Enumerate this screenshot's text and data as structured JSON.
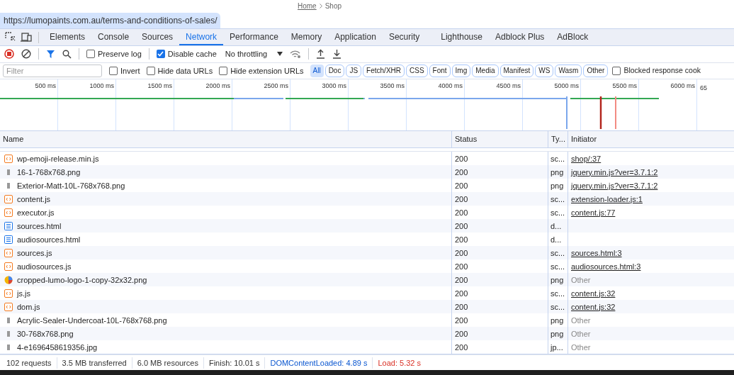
{
  "breadcrumb": {
    "items": [
      "Home",
      "Shop"
    ]
  },
  "url_tooltip": "https://lumopaints.com.au/terms-and-conditions-of-sales/",
  "tabs": [
    {
      "label": "Elements",
      "selected": false
    },
    {
      "label": "Console",
      "selected": false
    },
    {
      "label": "Sources",
      "selected": false
    },
    {
      "label": "Network",
      "selected": true
    },
    {
      "label": "Performance",
      "selected": false
    },
    {
      "label": "Memory",
      "selected": false
    },
    {
      "label": "Application",
      "selected": false
    },
    {
      "label": "Security",
      "selected": false
    },
    {
      "label": "Lighthouse",
      "selected": false
    },
    {
      "label": "Adblock Plus",
      "selected": false
    },
    {
      "label": "AdBlock",
      "selected": false
    }
  ],
  "toolbar": {
    "preserve_log": {
      "label": "Preserve log",
      "checked": false
    },
    "disable_cache": {
      "label": "Disable cache",
      "checked": true
    },
    "throttling": "No throttling"
  },
  "filter_bar": {
    "placeholder": "Filter",
    "checkboxes": [
      {
        "label": "Invert",
        "checked": false
      },
      {
        "label": "Hide data URLs",
        "checked": false
      },
      {
        "label": "Hide extension URLs",
        "checked": false
      }
    ],
    "types": [
      {
        "label": "All",
        "selected": true
      },
      {
        "label": "Doc",
        "selected": false
      },
      {
        "label": "JS",
        "selected": false
      },
      {
        "label": "Fetch/XHR",
        "selected": false
      },
      {
        "label": "CSS",
        "selected": false
      },
      {
        "label": "Font",
        "selected": false
      },
      {
        "label": "Img",
        "selected": false
      },
      {
        "label": "Media",
        "selected": false
      },
      {
        "label": "Manifest",
        "selected": false
      },
      {
        "label": "WS",
        "selected": false
      },
      {
        "label": "Wasm",
        "selected": false
      },
      {
        "label": "Other",
        "selected": false
      }
    ],
    "blocked_cookies": {
      "label": "Blocked response cook",
      "checked": false
    }
  },
  "timeline": {
    "ticks": [
      "500 ms",
      "1000 ms",
      "1500 ms",
      "2000 ms",
      "2500 ms",
      "3000 ms",
      "3500 ms",
      "4000 ms",
      "4500 ms",
      "5000 ms",
      "5500 ms",
      "6000 ms",
      "65"
    ]
  },
  "table": {
    "columns": [
      "Name",
      "Status",
      "Ty...",
      "Initiator"
    ],
    "rows": [
      {
        "name": "wp-emoji-release.min.js",
        "kind": "script",
        "status": "200",
        "type": "sc...",
        "initiator": "shop/:37",
        "initiator_link": true
      },
      {
        "name": "16-1-768x768.png",
        "kind": "image",
        "status": "200",
        "type": "png",
        "initiator": "jquery.min.js?ver=3.7.1:2",
        "initiator_link": true
      },
      {
        "name": "Exterior-Matt-10L-768x768.png",
        "kind": "image",
        "status": "200",
        "type": "png",
        "initiator": "jquery.min.js?ver=3.7.1:2",
        "initiator_link": true
      },
      {
        "name": "content.js",
        "kind": "script",
        "status": "200",
        "type": "sc...",
        "initiator": "extension-loader.js:1",
        "initiator_link": true
      },
      {
        "name": "executor.js",
        "kind": "script",
        "status": "200",
        "type": "sc...",
        "initiator": "content.js:77",
        "initiator_link": true
      },
      {
        "name": "sources.html",
        "kind": "document",
        "status": "200",
        "type": "d..."
      },
      {
        "name": "audiosources.html",
        "kind": "document",
        "status": "200",
        "type": "d..."
      },
      {
        "name": "sources.js",
        "kind": "script",
        "status": "200",
        "type": "sc...",
        "initiator": "sources.html:3",
        "initiator_link": true
      },
      {
        "name": "audiosources.js",
        "kind": "script",
        "status": "200",
        "type": "sc...",
        "initiator": "audiosources.html:3",
        "initiator_link": true
      },
      {
        "name": "cropped-lumo-logo-1-copy-32x32.png",
        "kind": "logo",
        "status": "200",
        "type": "png",
        "initiator": "Other",
        "initiator_link": false
      },
      {
        "name": "js.js",
        "kind": "script",
        "status": "200",
        "type": "sc...",
        "initiator": "content.js:32",
        "initiator_link": true
      },
      {
        "name": "dom.js",
        "kind": "script",
        "status": "200",
        "type": "sc...",
        "initiator": "content.js:32",
        "initiator_link": true
      },
      {
        "name": "Acrylic-Sealer-Undercoat-10L-768x768.png",
        "kind": "image",
        "status": "200",
        "type": "png",
        "initiator": "Other",
        "initiator_link": false
      },
      {
        "name": "30-768x768.png",
        "kind": "image",
        "status": "200",
        "type": "png",
        "initiator": "Other",
        "initiator_link": false
      },
      {
        "name": "4-e1696458619356.jpg",
        "kind": "image",
        "status": "200",
        "type": "jp...",
        "initiator": "Other",
        "initiator_link": false
      }
    ]
  },
  "status_bar": [
    {
      "text": "102 requests",
      "kind": "plain"
    },
    {
      "text": "3.5 MB transferred",
      "kind": "plain"
    },
    {
      "text": "6.0 MB resources",
      "kind": "plain"
    },
    {
      "text": "Finish: 10.01 s",
      "kind": "plain"
    },
    {
      "text": "DOMContentLoaded: 4.89 s",
      "kind": "dom"
    },
    {
      "text": "Load: 5.32 s",
      "kind": "load"
    }
  ]
}
